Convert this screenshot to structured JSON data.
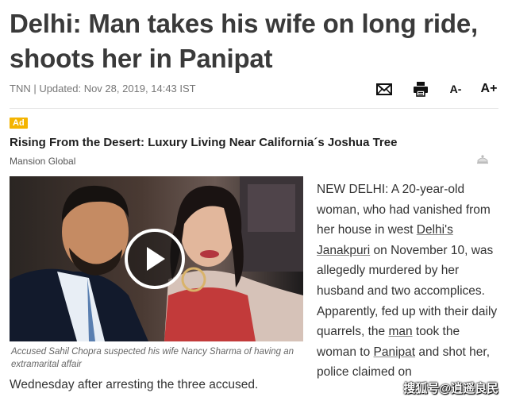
{
  "headline": "Delhi: Man takes his wife on long ride, shoots her in Panipat",
  "byline": "TNN | Updated: Nov 28, 2019, 14:43 IST",
  "tools": {
    "font_small": "A-",
    "font_large": "A+"
  },
  "ad": {
    "badge": "Ad",
    "title": "Rising From the Desert: Luxury Living Near California´s Joshua Tree",
    "source": "Mansion Global"
  },
  "caption": "Accused Sahil Chopra suspected his wife Nancy Sharma of having an extramarital affair",
  "article": {
    "p1": "NEW DELHI: A 20-year-old woman, who had vanished from her house in west ",
    "link1": "Delhi's",
    "p2": " ",
    "link2": "Janakpuri",
    "p3": " on November 10, was allegedly murdered by her husband and two accomplices. Apparently, fed up with their daily quarrels, the ",
    "link3": "man",
    "p4": " took the woman to ",
    "link4": "Panipat",
    "p5": " and shot her, police claimed on",
    "continuation": "Wednesday after arresting the three accused."
  },
  "watermark": "搜狐号@逍遥良民",
  "colors": {
    "ad_badge": "#f4b400",
    "headline": "#3a3a3a"
  }
}
